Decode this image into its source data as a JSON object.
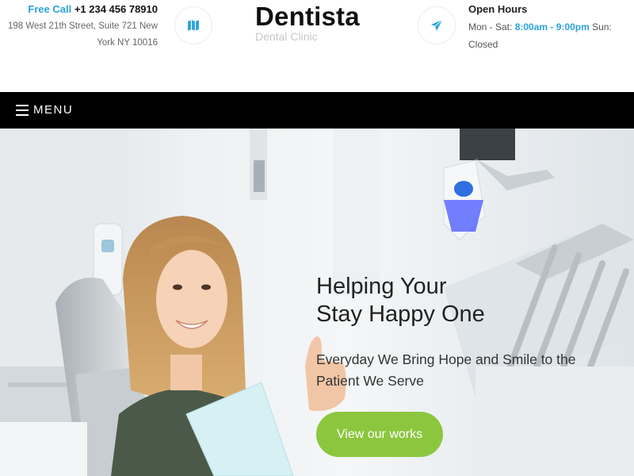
{
  "header": {
    "call_label": "Free Call",
    "call_number": "+1 234 456 78910",
    "address": "198 West 21th Street, Suite 721 New York NY 10016",
    "brand_name": "Dentista",
    "brand_tagline": "Dental Clinic",
    "hours_title": "Open Hours",
    "hours_days": "Mon - Sat:",
    "hours_time": "8:00am - 9:00pm",
    "hours_extra": "Sun: Closed",
    "map_icon": "map-icon",
    "send_icon": "paper-plane-icon"
  },
  "nav": {
    "menu_label": "MENU",
    "menu_icon": "hamburger-icon"
  },
  "hero": {
    "title_line1": "Helping Your",
    "title_line2": "Stay Happy One",
    "subtitle": "Everyday We Bring Hope and Smile to the Patient We Serve",
    "button_label": "View our works"
  },
  "colors": {
    "accent_blue": "#2ba3d9",
    "accent_green": "#8cc63f",
    "nav_bg": "#000000"
  }
}
